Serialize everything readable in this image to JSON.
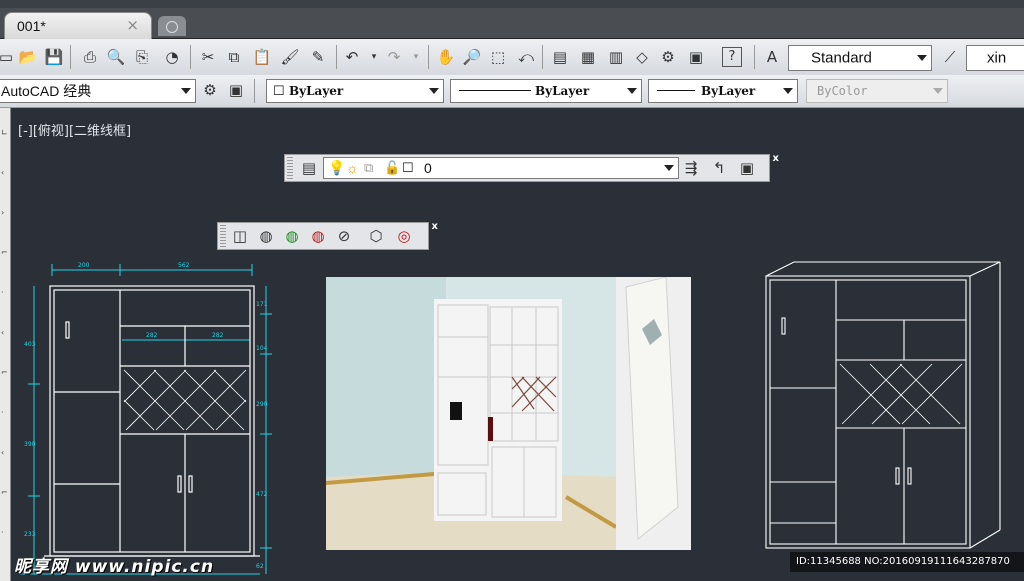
{
  "tabbar": {
    "tab_title": "001*",
    "close_glyph": "×"
  },
  "toolbar1": {
    "text_style": "Standard",
    "dim_style_partial": "xin"
  },
  "toolbar2": {
    "workspace": "AutoCAD 经典",
    "color": "ByLayer",
    "linetype": "ByLayer",
    "lineweight": "ByLayer",
    "plotstyle": "ByColor"
  },
  "canvas": {
    "view_label": "[-][俯视][二维线框]",
    "layer_combo_value": "0",
    "floating_close": "x"
  },
  "drawing": {
    "dims_top": [
      "200",
      "562"
    ],
    "dims_inner": [
      "282",
      "282"
    ],
    "dims_left": [
      "403",
      "390",
      "233"
    ],
    "dims_right": [
      "171",
      "104",
      "290",
      "472",
      "62"
    ]
  },
  "watermarks": {
    "brand": "昵享网 www.nipic.cn",
    "id_text": "ID:11345688 NO:20160919111643287870"
  },
  "colors": {
    "canvas_bg": "#2b2f38",
    "dim_cyan": "#1fd4e6",
    "line_white": "#ffffff"
  }
}
